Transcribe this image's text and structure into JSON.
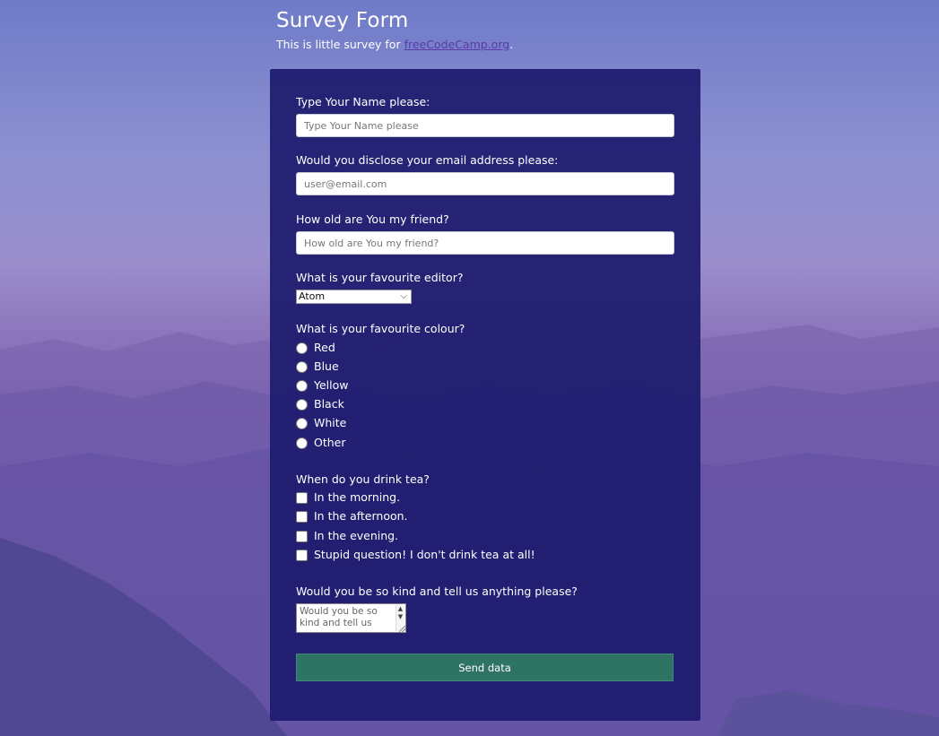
{
  "page": {
    "title": "Survey Form",
    "subtitle_prefix": "This is little survey for ",
    "subtitle_link": "freeCodeCamp.org",
    "subtitle_suffix": "."
  },
  "form": {
    "name_label": "Type Your Name please:",
    "name_placeholder": "Type Your Name please",
    "email_label": "Would you disclose your email address please:",
    "email_placeholder": "user@email.com",
    "age_label": "How old are You my friend?",
    "age_placeholder": "How old are You my friend?",
    "editor_label": "What is your favourite editor?",
    "editor_selected": "Atom",
    "colour_label": "What is your favourite colour?",
    "colours": [
      "Red",
      "Blue",
      "Yellow",
      "Black",
      "White",
      "Other"
    ],
    "tea_label": "When do you drink tea?",
    "tea_options": [
      "In the morning.",
      "In the afternoon.",
      "In the evening.",
      "Stupid question! I don't drink tea at all!"
    ],
    "comment_label": "Would you be so kind and tell us anything please?",
    "comment_placeholder": "Would you be so kind and tell us",
    "submit_label": "Send data"
  },
  "colors": {
    "card": "#1c1a6c",
    "button": "#2f7364",
    "link": "#5a3aa8"
  }
}
